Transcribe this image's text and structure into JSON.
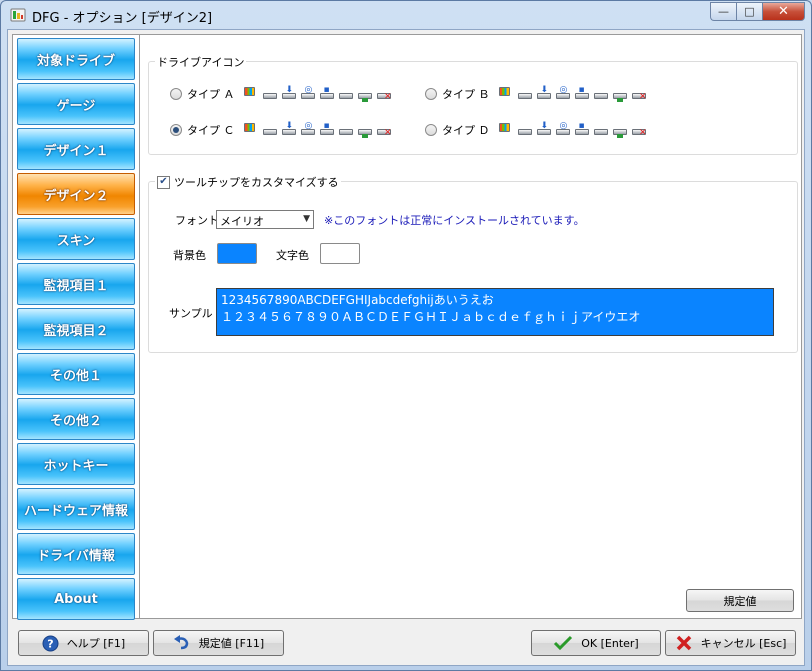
{
  "window": {
    "title": "DFG - オプション [デザイン2]",
    "icon": "dfg-app-icon",
    "controls": {
      "minimize": "—",
      "maximize": "□",
      "close": "✕"
    }
  },
  "sidebar": {
    "items": [
      {
        "label": "対象ドライブ",
        "active": false
      },
      {
        "label": "ゲージ",
        "active": false
      },
      {
        "label": "デザイン１",
        "active": false
      },
      {
        "label": "デザイン２",
        "active": true
      },
      {
        "label": "スキン",
        "active": false
      },
      {
        "label": "監視項目１",
        "active": false
      },
      {
        "label": "監視項目２",
        "active": false
      },
      {
        "label": "その他１",
        "active": false
      },
      {
        "label": "その他２",
        "active": false
      },
      {
        "label": "ホットキー",
        "active": false
      },
      {
        "label": "ハードウェア情報",
        "active": false
      },
      {
        "label": "ドライバ情報",
        "active": false
      },
      {
        "label": "About",
        "active": false
      }
    ]
  },
  "drive_icons": {
    "group_title": "ドライブアイコン",
    "options": [
      {
        "label": "タイプ Ａ",
        "selected": false
      },
      {
        "label": "タイプ Ｂ",
        "selected": false
      },
      {
        "label": "タイプ Ｃ",
        "selected": true
      },
      {
        "label": "タイプ Ｄ",
        "selected": false
      }
    ]
  },
  "tooltip": {
    "customize_label": "ツールチップをカスタマイズする",
    "customize_checked": true,
    "font_label": "フォント",
    "font_value": "メイリオ",
    "font_note": "※このフォントは正常にインストールされています。",
    "bg_color_label": "背景色",
    "text_color_label": "文字色",
    "bg_color": "#0a84ff",
    "text_color": "#ffffff",
    "sample_label": "サンプル",
    "sample_line1": "1234567890ABCDEFGHIJabcdefghijあいうえお",
    "sample_line2": "１２３４５６７８９０ＡＢＣＤＥＦＧＨＩＪａｂｃｄｅｆｇｈｉｊアイウエオ"
  },
  "panel_default_button": "規定値",
  "footer": {
    "help": "ヘルプ [F1]",
    "defaults": "規定値 [F11]",
    "ok": "OK [Enter]",
    "cancel": "キャンセル [Esc]"
  },
  "colors": {
    "nav_blue": "#18a6ee",
    "nav_active": "#f08600",
    "ok_check": "#2a9a2a",
    "cancel_x": "#d02020",
    "help_blue": "#2a5fb5"
  }
}
